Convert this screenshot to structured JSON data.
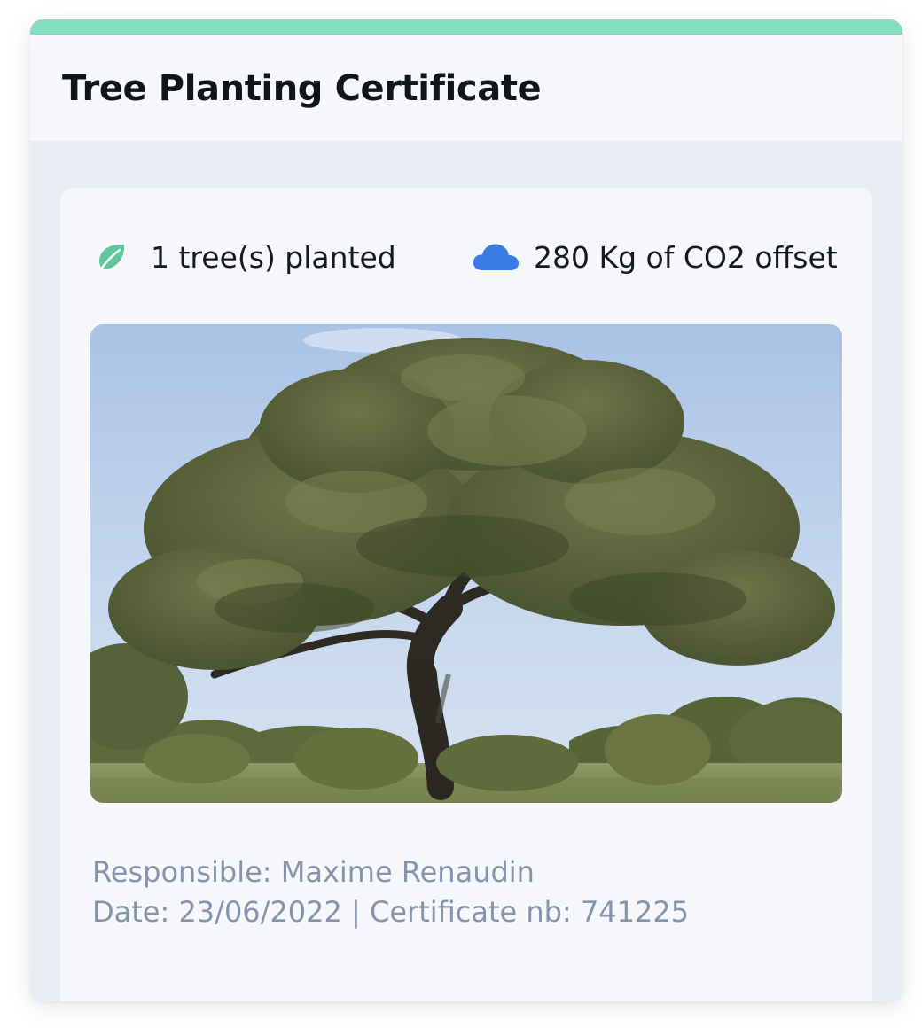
{
  "certificate": {
    "title": "Tree Planting Certificate",
    "accent_color": "#86dcc1"
  },
  "stats": {
    "trees": {
      "icon": "leaf-icon",
      "icon_color": "#5fc898",
      "label": "1 tree(s) planted"
    },
    "co2": {
      "icon": "cloud-icon",
      "icon_color": "#3b7be4",
      "label": "280 Kg of CO2 offset"
    }
  },
  "photo": {
    "subject": "tree-photo"
  },
  "details": {
    "responsible": "Responsible: Maxime Renaudin",
    "date_and_number": "Date: 23/06/2022 | Certificate nb: 741225"
  }
}
